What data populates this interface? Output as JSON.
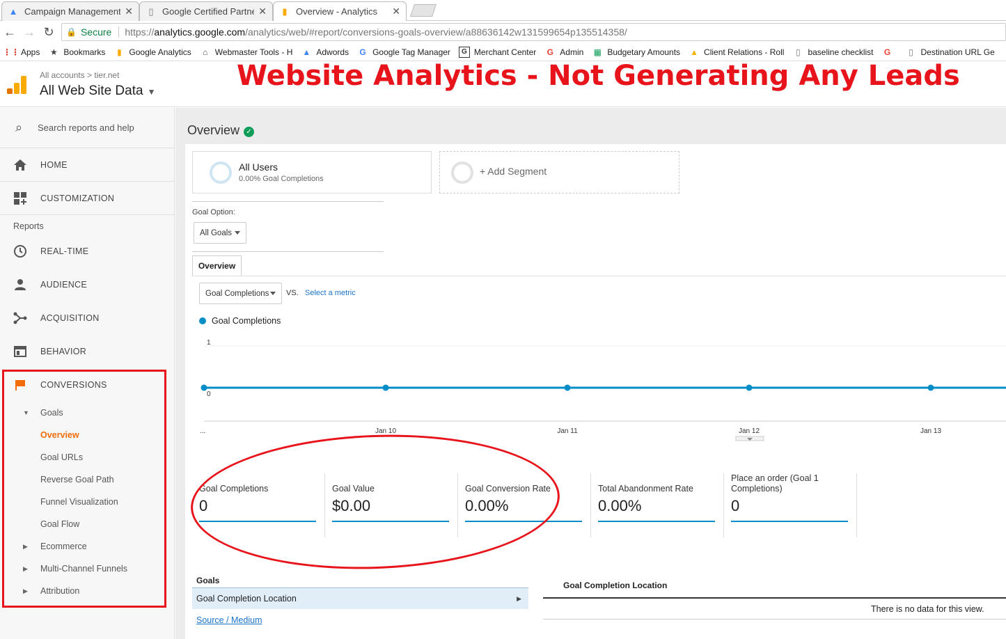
{
  "browser": {
    "tabs": [
      {
        "title": "Campaign Management",
        "icon": "adwords-icon"
      },
      {
        "title": "Google Certified Partner",
        "icon": "page-icon"
      },
      {
        "title": "Overview - Analytics",
        "icon": "analytics-icon"
      }
    ],
    "secure_label": "Secure",
    "url_scheme": "https://",
    "url_host": "analytics.google.com",
    "url_rest": "/analytics/web/#report/conversions-goals-overview/a88636142w131599654p135514358/",
    "bookmarks": [
      "Apps",
      "Bookmarks",
      "Google Analytics",
      "Webmaster Tools - H",
      "Adwords",
      "Google Tag Manager",
      "Merchant Center",
      "Admin",
      "Budgetary Amounts",
      "Client Relations - Roll",
      "baseline checklist",
      "Destination URL Ge"
    ]
  },
  "header": {
    "crumb_all": "All accounts",
    "crumb_sep": ">",
    "crumb_site": "tier.net",
    "view_name": "All Web Site Data",
    "banner": "Website Analytics - Not Generating Any Leads"
  },
  "sidebar": {
    "search_placeholder": "Search reports and help",
    "home": "HOME",
    "customization": "CUSTOMIZATION",
    "reports_label": "Reports",
    "realtime": "REAL-TIME",
    "audience": "AUDIENCE",
    "acquisition": "ACQUISITION",
    "behavior": "BEHAVIOR",
    "conversions": "CONVERSIONS",
    "goals": "Goals",
    "goal_items": [
      "Overview",
      "Goal URLs",
      "Reverse Goal Path",
      "Funnel Visualization",
      "Goal Flow"
    ],
    "ecommerce": "Ecommerce",
    "multichannel": "Multi-Channel Funnels",
    "attribution": "Attribution"
  },
  "main": {
    "title": "Overview",
    "segment_name": "All Users",
    "segment_sub": "0.00% Goal Completions",
    "add_segment": "+ Add Segment",
    "goal_option_label": "Goal Option:",
    "goal_option_value": "All Goals",
    "tab_overview": "Overview",
    "metric_select": "Goal Completions",
    "vs": "VS.",
    "select_metric": "Select a metric",
    "legend": "Goal Completions",
    "metrics": [
      {
        "label": "Goal Completions",
        "value": "0"
      },
      {
        "label": "Goal Value",
        "value": "$0.00"
      },
      {
        "label": "Goal Conversion Rate",
        "value": "0.00%"
      },
      {
        "label": "Total Abandonment Rate",
        "value": "0.00%"
      },
      {
        "label": "Place an order (Goal 1 Completions)",
        "value": "0"
      }
    ],
    "goals_heading": "Goals",
    "goal_completion_location": "Goal Completion Location",
    "source_medium": "Source / Medium",
    "gcl_heading": "Goal Completion Location",
    "no_data": "There is no data for this view."
  },
  "chart_data": {
    "type": "line",
    "series": [
      {
        "name": "Goal Completions",
        "values": [
          0,
          0,
          0,
          0,
          0,
          0
        ]
      }
    ],
    "categories": [
      "...",
      "Jan 10",
      "Jan 11",
      "Jan 12",
      "Jan 13",
      ""
    ],
    "ylim": [
      0,
      1
    ],
    "yticks": [
      "0",
      "1"
    ],
    "color": "#058dc7"
  }
}
